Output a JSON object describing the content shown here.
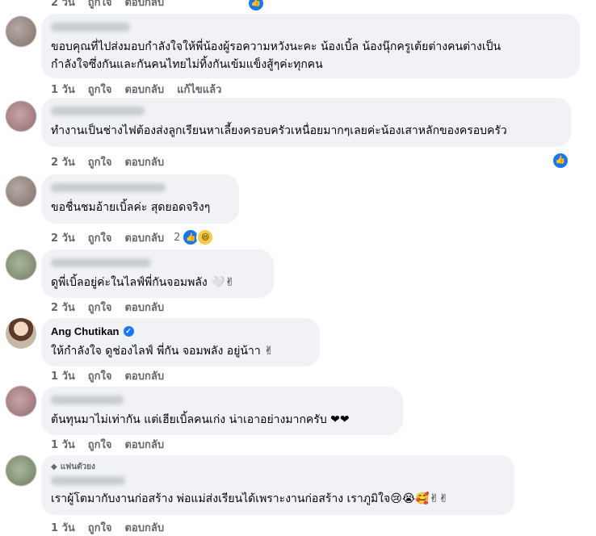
{
  "top_partial": {
    "time": "2 วัน",
    "like": "ถูกใจ",
    "reply": "ตอบกลับ"
  },
  "comments": [
    {
      "text_line1": "ขอบคุณที่ไปส่งมอบกำลังใจให้พี่น้องผู้รอความหวังนะคะ น้องเบิ้ล น้องนุ๊กครูเต้ยต่างคนต่างเป็น",
      "text_line2": "กำลังใจซึ่งกันและกันคนไทยไม่ทิ้งกันเข้มแข็งสู้ๆค่ะทุกคน",
      "time": "1 วัน",
      "like": "ถูกใจ",
      "reply": "ตอบกลับ",
      "edited": "แก้ไขแล้ว"
    },
    {
      "text": "ทำงานเป็นช่างไฟต้องส่งลูกเรียนหาเลี้ยงครอบครัวเหนื่อยมากๆเลยค่ะน้องเสาหลักของครอบครัว",
      "time": "2 วัน",
      "like": "ถูกใจ",
      "reply": "ตอบกลับ"
    },
    {
      "text": "ขอชื่นชมอ้ายเบิ้ลค่ะ สุดยอดจริงๆ",
      "time": "2 วัน",
      "like": "ถูกใจ",
      "reply": "ตอบกลับ",
      "reaction_count": "2"
    },
    {
      "text": "ดูพี่เบิ้ลอยู่ค่ะในไลฟ์พี่กันจอมพลัง 🤍✌",
      "time": "2 วัน",
      "like": "ถูกใจ",
      "reply": "ตอบกลับ"
    },
    {
      "name": "Ang Chutikan",
      "text": "ให้กำลังใจ ดูช่องไลฟ์ พี่กัน จอมพลัง อยู่น้าา ✌",
      "time": "1 วัน",
      "like": "ถูกใจ",
      "reply": "ตอบกลับ"
    },
    {
      "text": "ต้นทุนมาไม่เท่ากัน แต่เฮียเบิ้ลคนเก่ง น่าเอาอย่างมากครับ ❤❤",
      "time": "1 วัน",
      "like": "ถูกใจ",
      "reply": "ตอบกลับ"
    },
    {
      "badge": "แฟนตัวยง",
      "text": "เราผู้โตมากับงานก่อสร้าง พ่อแม่ส่งเรียนได้เพราะงานก่อสร้าง เราภูมิใจ😢😭🥰✌✌",
      "time": "1 วัน",
      "like": "ถูกใจ",
      "reply": "ตอบกลับ"
    }
  ],
  "icons": {
    "like": "like-icon",
    "haha": "haha-icon",
    "verified": "verified-icon",
    "badge": "diamond-icon"
  },
  "colors": {
    "bubble": "#f0f2f5",
    "meta": "#65676b",
    "like_blue": "#1877f2"
  }
}
